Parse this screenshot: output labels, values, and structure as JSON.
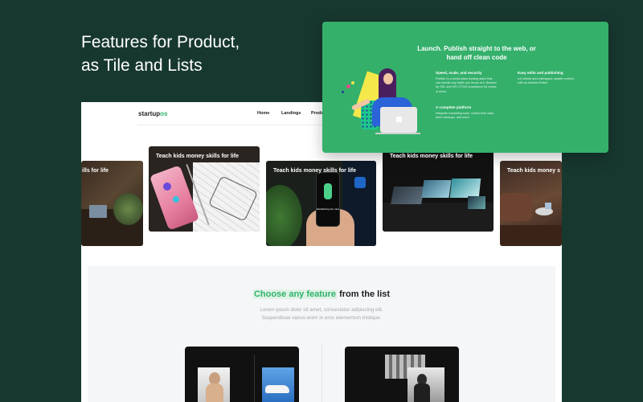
{
  "hero": {
    "title_line1": "Features for Product,",
    "title_line2": "as Tile and Lists"
  },
  "nav": {
    "logo_main": "startup",
    "logo_accent": "os",
    "links": [
      "Home",
      "Landings",
      "Produ"
    ]
  },
  "tiles": {
    "t1": "ills for life",
    "t2": "Teach kids money skills for life",
    "t3": "Teach kids money skills for life",
    "t4": "Teach kids money skills for life",
    "t5": "Teach kids money s"
  },
  "phone_screen_text": "Establishing the rules",
  "features": {
    "title_highlight": "Choose any feature",
    "title_rest": " from the list",
    "subtitle_line1": "Lorem ipsum dolor sit amet, consectetur adipiscing elit.",
    "subtitle_line2": "Suspendisse varius enim in eros elementum tristique."
  },
  "card": {
    "title_line1": "Launch. Publish straight to the web, or",
    "title_line2": "hand off clean code",
    "features": [
      {
        "heading": "Speed, scale, and security",
        "lines": [
          "Publish to a world-class hosting stack that",
          "can handle any traffic you throw at it. Backed",
          "by SSL and ISO 27018 compliance for peace",
          "of mind."
        ]
      },
      {
        "heading": "Easy edits and publishing",
        "lines": [
          "Let clients and colleagues update content",
          "with an intuitive Editor."
        ]
      },
      {
        "heading": "A complete platform",
        "lines": [
          "Integrate marketing tools, collect form data,",
          "store backups, and more."
        ]
      }
    ]
  },
  "colors": {
    "background": "#17382f",
    "accent_green": "#34b06b",
    "page": "#ffffff",
    "section": "#f4f6f7"
  }
}
